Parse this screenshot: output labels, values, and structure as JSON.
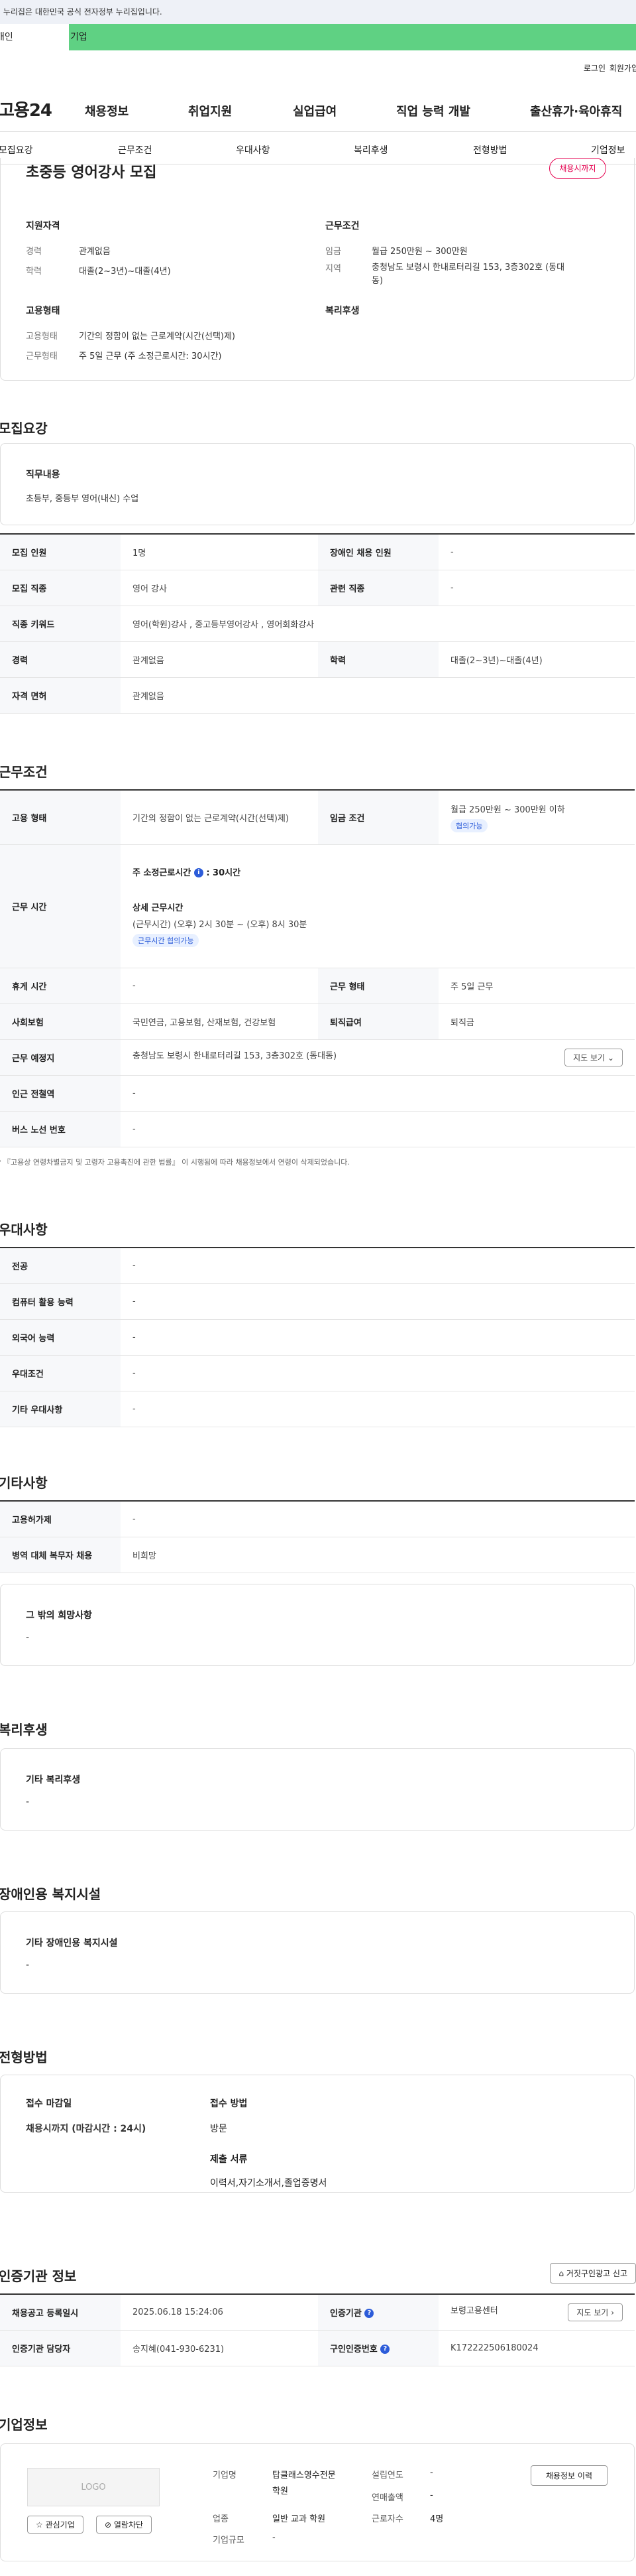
{
  "gov_banner": "이 누리집은 대한민국 공식 전자정부 누리집입니다.",
  "user_tabs": {
    "individual": "개인",
    "business": "기업"
  },
  "util": {
    "login": "로그인",
    "join": "회원가입"
  },
  "gnb": {
    "logo": "고용24",
    "menu": [
      "채용정보",
      "취업지원",
      "실업급여",
      "직업 능력 개발",
      "출산휴가·육아휴직"
    ]
  },
  "anchors": [
    "모집요강",
    "근무조건",
    "우대사항",
    "복리후생",
    "전형방법",
    "기업정보"
  ],
  "summary": {
    "title": "초중등 영어강사 모집",
    "badge": "채용시까지",
    "qual_h": "지원자격",
    "career_k": "경력",
    "career_v": "관계없음",
    "edu_k": "학력",
    "edu_v": "대졸(2~3년)~대졸(4년)",
    "cond_h": "근무조건",
    "wage_k": "임금",
    "wage_v": "월급 250만원 ~ 300만원",
    "region_k": "지역",
    "region_v1": "충청남도 보령시 한내로터리길 153, 3층302호 (동대",
    "region_v2": "동)",
    "emp_h": "고용형태",
    "emptype_k": "고용형태",
    "emptype_v": "기간의 정함이 없는 근로계약(시간(선택)제)",
    "worktype_k": "근무형태",
    "worktype_v": "주 5일 근무 (주 소정근로시간: 30시간)",
    "welfare_h": "복리후생"
  },
  "recruit": {
    "h": "모집요강",
    "job_h": "직무내용",
    "job_v": "초등부, 중등부 영어(내신) 수업",
    "rows": [
      {
        "k1": "모집 인원",
        "v1": "1명",
        "k2": "장애인 채용 인원",
        "v2": "-"
      },
      {
        "k1": "모집 직종",
        "v1": "영어 강사",
        "k2": "관련 직종",
        "v2": "-"
      },
      {
        "k1": "직종 키워드",
        "v1": "영어(학원)강사 , 중고등부영어강사 , 영어회화강사"
      },
      {
        "k1": "경력",
        "v1": "관계없음",
        "k2": "학력",
        "v2": "대졸(2~3년)~대졸(4년)"
      },
      {
        "k1": "자격 면허",
        "v1": "관계없음"
      }
    ]
  },
  "conditions": {
    "h": "근무조건",
    "emp_k": "고용 형태",
    "emp_v": "기간의 정함이 없는 근로계약(시간(선택)제)",
    "wage_k": "임금 조건",
    "wage_v": "월급 250만원 ~ 300만원 이하",
    "wage_pill": "협의가능",
    "hours_k": "근무 시간",
    "hours_title": "주 소정근로시간",
    "hours_val": ": 30시간",
    "detail_h": "상세 근무시간",
    "detail_v": "(근무시간) (오후) 2시 30분 ~ (오후) 8시 30분",
    "detail_pill": "근무시간 협의가능",
    "rest_k": "휴게 시간",
    "rest_v": "-",
    "wtype_k": "근무 형태",
    "wtype_v": "주 5일 근무",
    "ins_k": "사회보험",
    "ins_v": "국민연금, 고용보험, 산재보험, 건강보험",
    "ret_k": "퇴직급여",
    "ret_v": "퇴직금",
    "place_k": "근무 예정지",
    "place_v": "충청남도 보령시 한내로터리길 153, 3층302호 (동대동)",
    "map_btn": "지도 보기",
    "subway_k": "인근 전철역",
    "subway_v": "-",
    "bus_k": "버스 노선 번호",
    "bus_v": "-",
    "note": "* 『고용상 연령차별금지 및 고령자 고용촉진에 관한 법률』 이 시행됨에 따라 채용정보에서 연령이 삭제되었습니다."
  },
  "preference": {
    "h": "우대사항",
    "rows": [
      {
        "k": "전공",
        "v": "-"
      },
      {
        "k": "컴퓨터 활용 능력",
        "v": "-"
      },
      {
        "k": "외국어 능력",
        "v": "-"
      },
      {
        "k": "우대조건",
        "v": "-"
      },
      {
        "k": "기타 우대사항",
        "v": "-"
      }
    ]
  },
  "etc": {
    "h": "기타사항",
    "rows": [
      {
        "k": "고용허가제",
        "v": "-"
      },
      {
        "k": "병역 대체 복무자 채용",
        "v": "비희망"
      }
    ],
    "hope_h": "그 밖의 희망사항",
    "hope_v": "-"
  },
  "welfare": {
    "h": "복리후생",
    "bt": "기타 복리후생",
    "bv": "-"
  },
  "disabled": {
    "h": "장애인용 복지시설",
    "bt": "기타 장애인용 복지시설",
    "bv": "-"
  },
  "selection": {
    "h": "전형방법",
    "deadline_h": "접수 마감일",
    "deadline_v": "채용시까지 (마감시간 : 24시)",
    "method_h": "접수 방법",
    "method_v": "방문",
    "docs_h": "제출 서류",
    "docs_v": "이력서,자기소개서,졸업증명서"
  },
  "cert": {
    "h": "인증기관 정보",
    "report_btn": "거짓구인광고 신고",
    "reg_k": "채용공고 등록일시",
    "reg_v": "2025.06.18 15:24:06",
    "org_k": "인증기관",
    "org_v": "보령고용센터",
    "map_btn": "지도 보기",
    "mgr_k": "인증기관 담당자",
    "mgr_v": "송지혜(041-930-6231)",
    "no_k": "구인인증번호",
    "no_v": "K172222506180024"
  },
  "company": {
    "h": "기업정보",
    "logo": "LOGO",
    "fav_btn": "관심기업",
    "block_btn": "열람차단",
    "name_k": "기업명",
    "name_v1": "탑클래스영수전문",
    "name_v2": "학원",
    "industry_k": "업종",
    "industry_v": "일반 교과 학원",
    "size_k": "기업규모",
    "size_v": "-",
    "year_k": "설립연도",
    "year_v": "-",
    "sales_k": "연매출액",
    "sales_v": "-",
    "staff_k": "근로자수",
    "staff_v": "4명",
    "history_btn": "채용정보 이력"
  }
}
